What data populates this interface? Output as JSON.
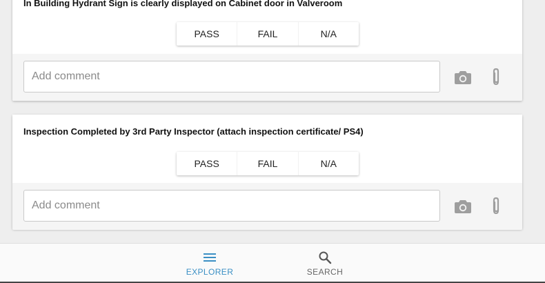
{
  "checklist": {
    "options": [
      "PASS",
      "FAIL",
      "N/A"
    ],
    "comment_placeholder": "Add comment",
    "items": [
      {
        "question": "In Building Hydrant Sign is clearly displayed on Cabinet door in Valveroom"
      },
      {
        "question": "Inspection Completed by 3rd Party Inspector (attach inspection certificate/ PS4)"
      }
    ]
  },
  "icons": {
    "camera": "camera-icon",
    "attach": "paperclip-icon",
    "explorer": "menu-icon",
    "search": "search-icon"
  },
  "bottom_nav": {
    "explorer_label": "EXPLORER",
    "search_label": "SEARCH"
  },
  "colors": {
    "active": "#3a8fc4",
    "inactive": "#666666",
    "icon_gray": "#9e9e9e"
  }
}
